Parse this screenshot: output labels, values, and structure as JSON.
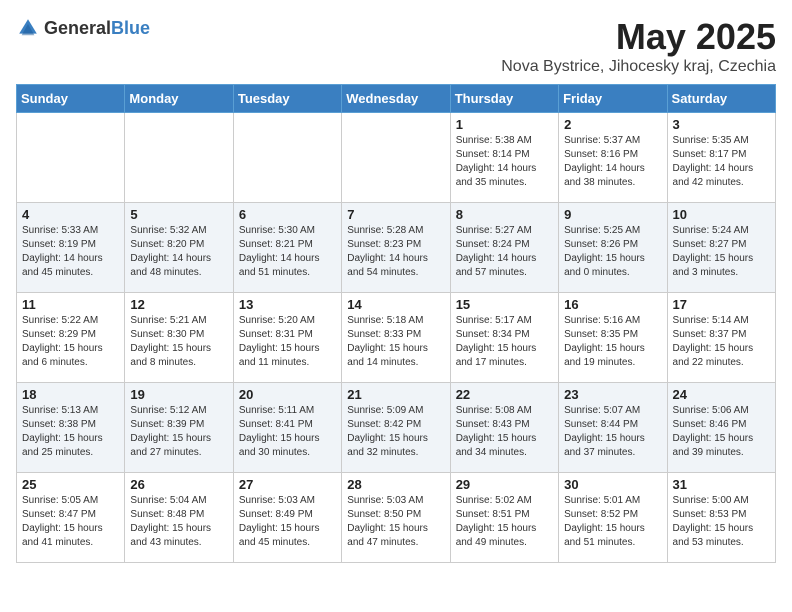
{
  "logo": {
    "general": "General",
    "blue": "Blue"
  },
  "title": "May 2025",
  "subtitle": "Nova Bystrice, Jihocesky kraj, Czechia",
  "days": [
    "Sunday",
    "Monday",
    "Tuesday",
    "Wednesday",
    "Thursday",
    "Friday",
    "Saturday"
  ],
  "weeks": [
    [
      {
        "day": "",
        "info": ""
      },
      {
        "day": "",
        "info": ""
      },
      {
        "day": "",
        "info": ""
      },
      {
        "day": "",
        "info": ""
      },
      {
        "day": "1",
        "info": "Sunrise: 5:38 AM\nSunset: 8:14 PM\nDaylight: 14 hours\nand 35 minutes."
      },
      {
        "day": "2",
        "info": "Sunrise: 5:37 AM\nSunset: 8:16 PM\nDaylight: 14 hours\nand 38 minutes."
      },
      {
        "day": "3",
        "info": "Sunrise: 5:35 AM\nSunset: 8:17 PM\nDaylight: 14 hours\nand 42 minutes."
      }
    ],
    [
      {
        "day": "4",
        "info": "Sunrise: 5:33 AM\nSunset: 8:19 PM\nDaylight: 14 hours\nand 45 minutes."
      },
      {
        "day": "5",
        "info": "Sunrise: 5:32 AM\nSunset: 8:20 PM\nDaylight: 14 hours\nand 48 minutes."
      },
      {
        "day": "6",
        "info": "Sunrise: 5:30 AM\nSunset: 8:21 PM\nDaylight: 14 hours\nand 51 minutes."
      },
      {
        "day": "7",
        "info": "Sunrise: 5:28 AM\nSunset: 8:23 PM\nDaylight: 14 hours\nand 54 minutes."
      },
      {
        "day": "8",
        "info": "Sunrise: 5:27 AM\nSunset: 8:24 PM\nDaylight: 14 hours\nand 57 minutes."
      },
      {
        "day": "9",
        "info": "Sunrise: 5:25 AM\nSunset: 8:26 PM\nDaylight: 15 hours\nand 0 minutes."
      },
      {
        "day": "10",
        "info": "Sunrise: 5:24 AM\nSunset: 8:27 PM\nDaylight: 15 hours\nand 3 minutes."
      }
    ],
    [
      {
        "day": "11",
        "info": "Sunrise: 5:22 AM\nSunset: 8:29 PM\nDaylight: 15 hours\nand 6 minutes."
      },
      {
        "day": "12",
        "info": "Sunrise: 5:21 AM\nSunset: 8:30 PM\nDaylight: 15 hours\nand 8 minutes."
      },
      {
        "day": "13",
        "info": "Sunrise: 5:20 AM\nSunset: 8:31 PM\nDaylight: 15 hours\nand 11 minutes."
      },
      {
        "day": "14",
        "info": "Sunrise: 5:18 AM\nSunset: 8:33 PM\nDaylight: 15 hours\nand 14 minutes."
      },
      {
        "day": "15",
        "info": "Sunrise: 5:17 AM\nSunset: 8:34 PM\nDaylight: 15 hours\nand 17 minutes."
      },
      {
        "day": "16",
        "info": "Sunrise: 5:16 AM\nSunset: 8:35 PM\nDaylight: 15 hours\nand 19 minutes."
      },
      {
        "day": "17",
        "info": "Sunrise: 5:14 AM\nSunset: 8:37 PM\nDaylight: 15 hours\nand 22 minutes."
      }
    ],
    [
      {
        "day": "18",
        "info": "Sunrise: 5:13 AM\nSunset: 8:38 PM\nDaylight: 15 hours\nand 25 minutes."
      },
      {
        "day": "19",
        "info": "Sunrise: 5:12 AM\nSunset: 8:39 PM\nDaylight: 15 hours\nand 27 minutes."
      },
      {
        "day": "20",
        "info": "Sunrise: 5:11 AM\nSunset: 8:41 PM\nDaylight: 15 hours\nand 30 minutes."
      },
      {
        "day": "21",
        "info": "Sunrise: 5:09 AM\nSunset: 8:42 PM\nDaylight: 15 hours\nand 32 minutes."
      },
      {
        "day": "22",
        "info": "Sunrise: 5:08 AM\nSunset: 8:43 PM\nDaylight: 15 hours\nand 34 minutes."
      },
      {
        "day": "23",
        "info": "Sunrise: 5:07 AM\nSunset: 8:44 PM\nDaylight: 15 hours\nand 37 minutes."
      },
      {
        "day": "24",
        "info": "Sunrise: 5:06 AM\nSunset: 8:46 PM\nDaylight: 15 hours\nand 39 minutes."
      }
    ],
    [
      {
        "day": "25",
        "info": "Sunrise: 5:05 AM\nSunset: 8:47 PM\nDaylight: 15 hours\nand 41 minutes."
      },
      {
        "day": "26",
        "info": "Sunrise: 5:04 AM\nSunset: 8:48 PM\nDaylight: 15 hours\nand 43 minutes."
      },
      {
        "day": "27",
        "info": "Sunrise: 5:03 AM\nSunset: 8:49 PM\nDaylight: 15 hours\nand 45 minutes."
      },
      {
        "day": "28",
        "info": "Sunrise: 5:03 AM\nSunset: 8:50 PM\nDaylight: 15 hours\nand 47 minutes."
      },
      {
        "day": "29",
        "info": "Sunrise: 5:02 AM\nSunset: 8:51 PM\nDaylight: 15 hours\nand 49 minutes."
      },
      {
        "day": "30",
        "info": "Sunrise: 5:01 AM\nSunset: 8:52 PM\nDaylight: 15 hours\nand 51 minutes."
      },
      {
        "day": "31",
        "info": "Sunrise: 5:00 AM\nSunset: 8:53 PM\nDaylight: 15 hours\nand 53 minutes."
      }
    ]
  ]
}
